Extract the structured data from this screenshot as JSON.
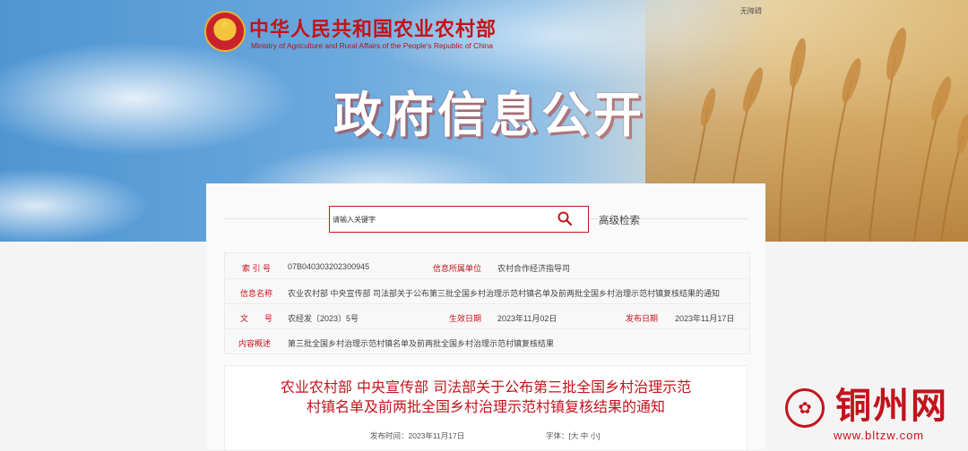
{
  "header": {
    "site_title_cn": "中华人民共和国农业农村部",
    "site_title_en": "Ministry of Agriculture and Rural Affairs of the People's Republic of China",
    "top_link": "无障碍",
    "banner_title": "政府信息公开"
  },
  "search": {
    "placeholder": "请输入关键字",
    "advanced_label": "高级检索"
  },
  "info": {
    "index_label": "索 引 号",
    "index_value": "07B040303202300945",
    "unit_label": "信息所属单位",
    "unit_value": "农村合作经济指导司",
    "name_label": "信息名称",
    "name_value": "农业农村部 中央宣传部 司法部关于公布第三批全国乡村治理示范村镇名单及前两批全国乡村治理示范村镇复核结果的通知",
    "doc_label": "文　　号",
    "doc_value": "农经发〔2023〕5号",
    "effective_label": "生效日期",
    "effective_value": "2023年11月02日",
    "publish_label": "发布日期",
    "publish_value": "2023年11月17日",
    "summary_label": "内容概述",
    "summary_value": "第三批全国乡村治理示范村镇名单及前两批全国乡村治理示范村镇复核结果"
  },
  "article": {
    "title_line1": "农业农村部 中央宣传部 司法部关于公布第三批全国乡村治理示范",
    "title_line2": "村镇名单及前两批全国乡村治理示范村镇复核结果的通知",
    "publish_time": "发布时间：2023年11月17日",
    "font_size_label": "字体：[大 中 小]"
  },
  "watermark": {
    "name": "铜州网",
    "url": "www.bltzw.com"
  },
  "colors": {
    "brand_red": "#c3131b"
  }
}
